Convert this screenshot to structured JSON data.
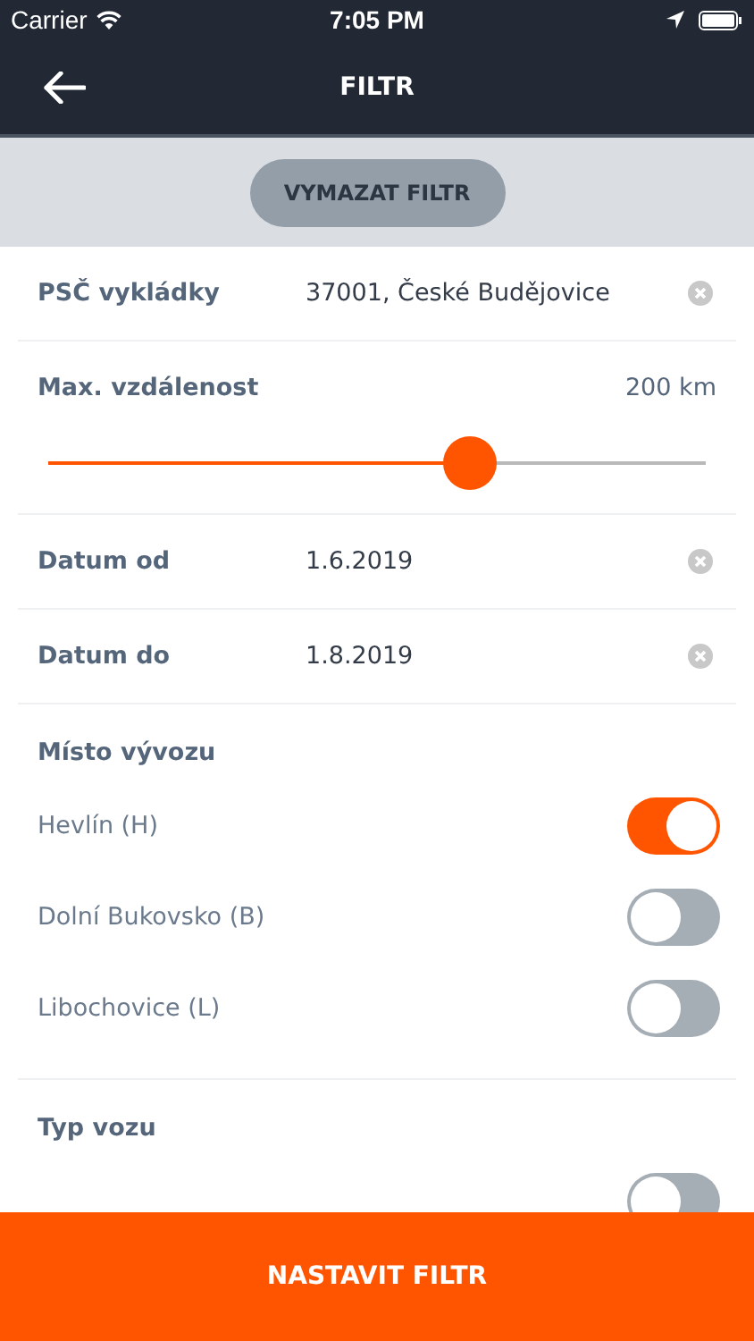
{
  "status_bar": {
    "carrier": "Carrier",
    "time": "7:05 PM"
  },
  "nav": {
    "title": "FILTR"
  },
  "clear_button": "VYMAZAT FILTR",
  "fields": [
    {
      "label": "PSČ vykládky",
      "value": "37001, České Budějovice"
    }
  ],
  "distance": {
    "label": "Max. vzdálenost",
    "reading": "200 km",
    "level": 0.64
  },
  "dates": [
    {
      "label": "Datum od",
      "value": "1.6.2019"
    },
    {
      "label": "Datum do",
      "value": "1.8.2019"
    }
  ],
  "sections": [
    {
      "title": "Místo vývozu",
      "items": [
        {
          "label": "Hevlín (H)",
          "on": true
        },
        {
          "label": "Dolní Bukovsko (B)",
          "on": false
        },
        {
          "label": "Libochovice (L)",
          "on": false
        }
      ]
    },
    {
      "title": "Typ vozu",
      "items": [
        {
          "on": false
        }
      ]
    }
  ],
  "submit_button": "NASTAVIT FILTR"
}
